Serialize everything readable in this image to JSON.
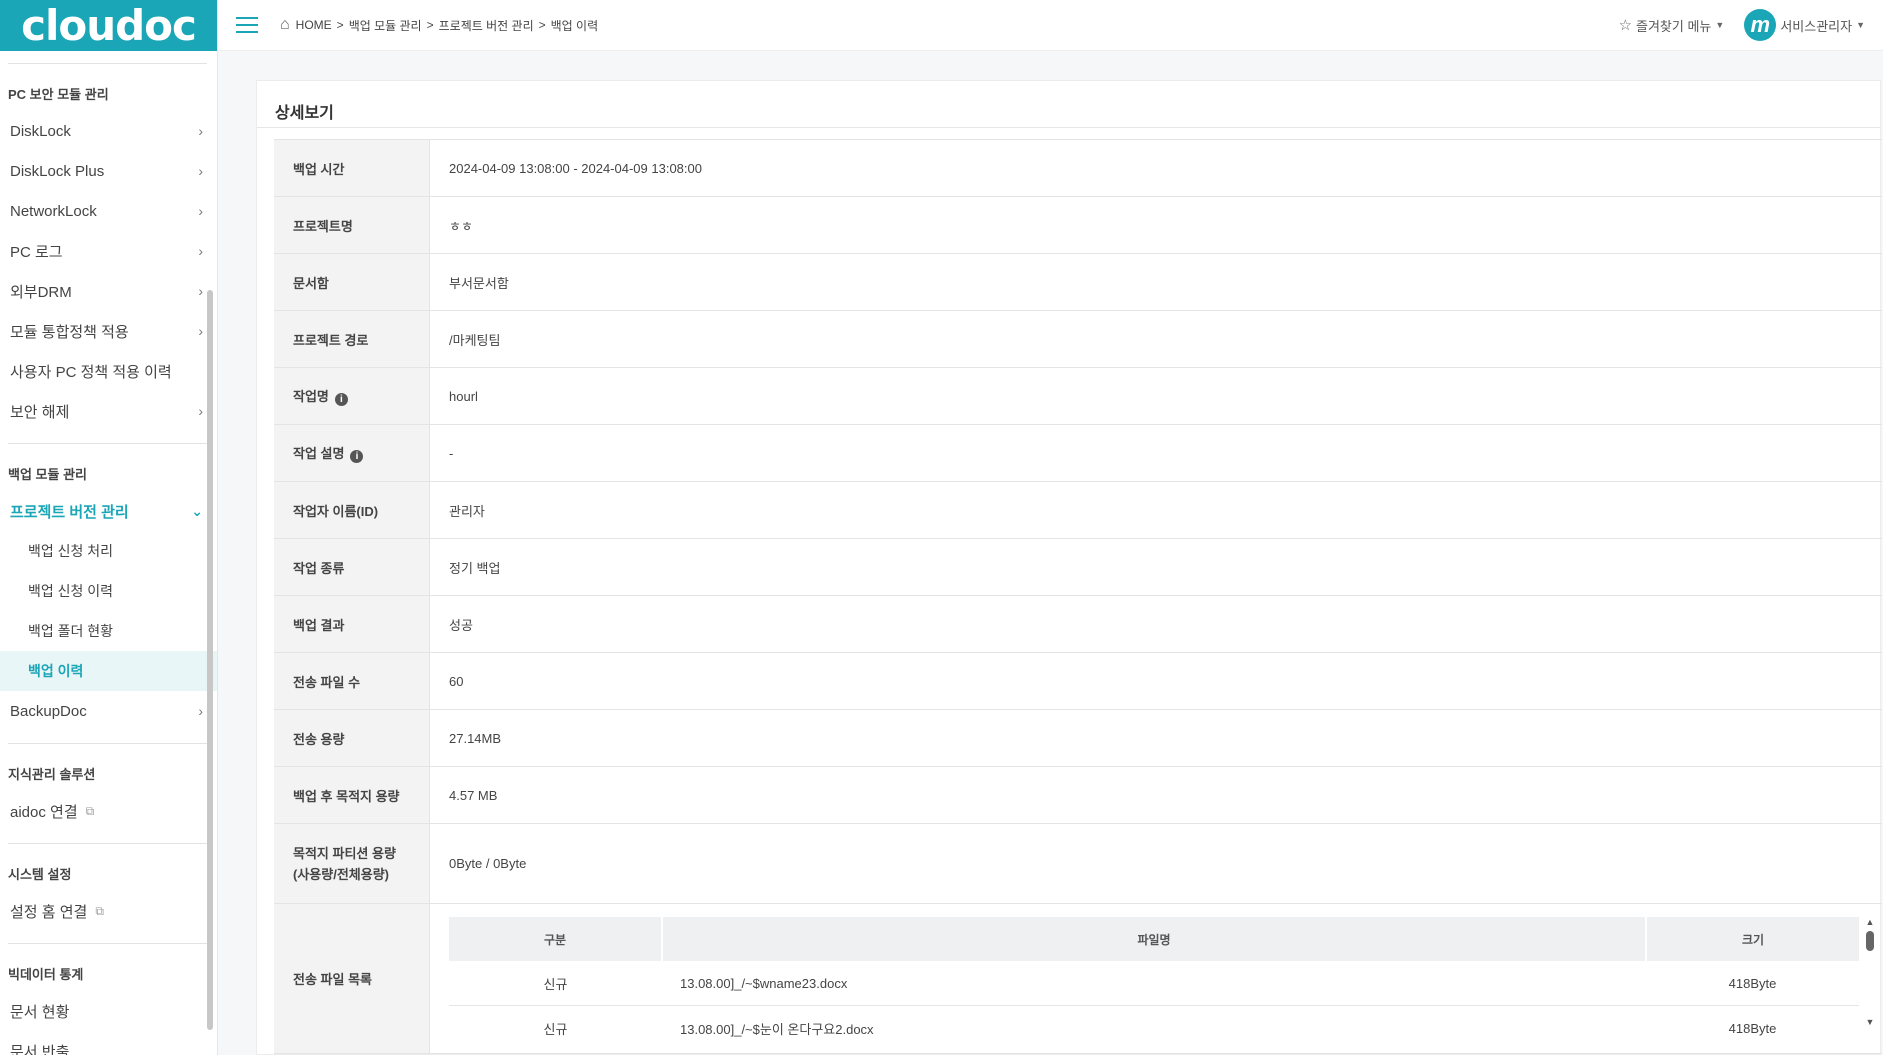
{
  "app": {
    "logo_text": "cloudoc",
    "accent": "#1aa6b7"
  },
  "sidebar": {
    "sections": [
      {
        "title": "PC 보안 모듈 관리"
      },
      {
        "title": "백업 모듈 관리"
      },
      {
        "title": "지식관리 솔루션"
      },
      {
        "title": "시스템 설정"
      },
      {
        "title": "빅데이터 통계"
      }
    ],
    "pc_items": [
      "DiskLock",
      "DiskLock Plus",
      "NetworkLock",
      "PC 로그",
      "외부DRM",
      "모듈 통합정책 적용",
      "사용자 PC 정책 적용 이력",
      "보안 해제"
    ],
    "backup_parent": "프로젝트 버전 관리",
    "backup_sub": [
      "백업 신청 처리",
      "백업 신청 이력",
      "백업 폴더 현황",
      "백업 이력"
    ],
    "backup_doc": "BackupDoc",
    "knowledge_item": "aidoc 연결",
    "system_item": "설정 홈 연결",
    "bigdata_items": [
      "문서 현황",
      "문서 반출"
    ]
  },
  "topbar": {
    "breadcrumb": [
      "HOME",
      "백업 모듈 관리",
      "프로젝트 버전 관리",
      "백업 이력"
    ],
    "favorites_label": "즐겨찾기 메뉴",
    "avatar_letter": "m",
    "user_label": "서비스관리자"
  },
  "detail": {
    "title": "상세보기",
    "rows": [
      {
        "label": "백업 시간",
        "value": "2024-04-09 13:08:00 - 2024-04-09 13:08:00"
      },
      {
        "label": "프로젝트명",
        "value": "ㅎㅎ"
      },
      {
        "label": "문서함",
        "value": "부서문서함"
      },
      {
        "label": "프로젝트 경로",
        "value": "/마케팅팀"
      },
      {
        "label": "작업명",
        "value": "hourl"
      },
      {
        "label": "작업 설명",
        "value": "-"
      },
      {
        "label": "작업자 이름(ID)",
        "value": "관리자"
      },
      {
        "label": "작업 종류",
        "value": "정기 백업"
      },
      {
        "label": "백업 결과",
        "value": "성공"
      },
      {
        "label": "전송 파일 수",
        "value": "60"
      },
      {
        "label": "전송 용량",
        "value": "27.14MB"
      },
      {
        "label": "백업 후 목적지 용량",
        "value": "4.57 MB"
      },
      {
        "label_line1": "목적지 파티션 용량",
        "label_line2": "(사용량/전체용량)",
        "value": "0Byte / 0Byte"
      },
      {
        "label": "전송 파일 목록"
      }
    ],
    "files": {
      "headers": [
        "구분",
        "파일명",
        "크기"
      ],
      "rows": [
        {
          "type": "신규",
          "name": "13.08.00]_/~$wname23.docx",
          "size": "418Byte"
        },
        {
          "type": "신규",
          "name": "13.08.00]_/~$눈이 온다구요2.docx",
          "size": "418Byte"
        }
      ]
    }
  }
}
